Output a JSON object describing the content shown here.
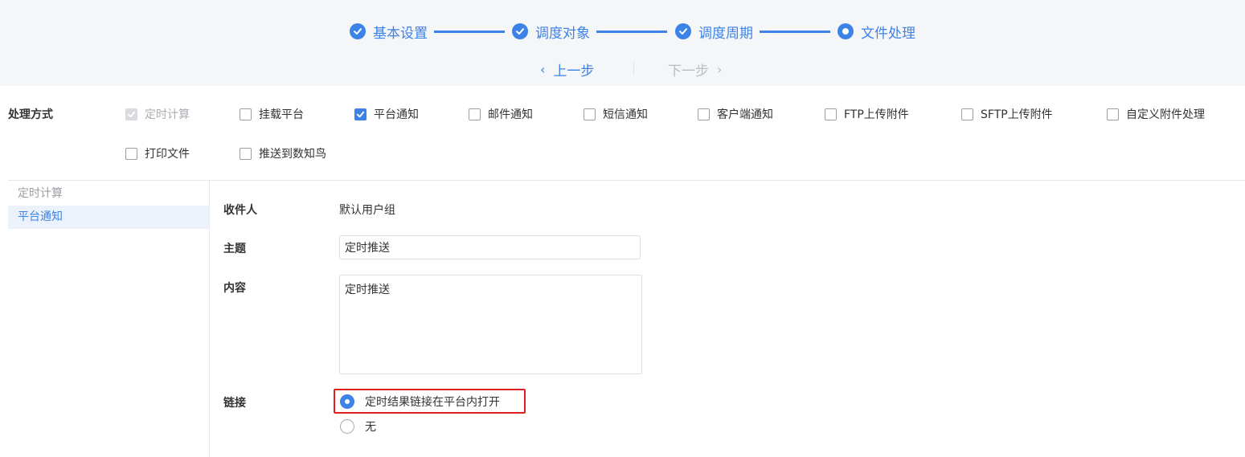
{
  "stepper": {
    "steps": [
      {
        "label": "基本设置",
        "state": "done"
      },
      {
        "label": "调度对象",
        "state": "done"
      },
      {
        "label": "调度周期",
        "state": "done"
      },
      {
        "label": "文件处理",
        "state": "current"
      }
    ],
    "prev_label": "上一步",
    "next_label": "下一步"
  },
  "methods": {
    "title": "处理方式",
    "options": [
      {
        "label": "定时计算",
        "checked": true,
        "disabled": true
      },
      {
        "label": "挂载平台",
        "checked": false
      },
      {
        "label": "平台通知",
        "checked": true
      },
      {
        "label": "邮件通知",
        "checked": false
      },
      {
        "label": "短信通知",
        "checked": false
      },
      {
        "label": "客户端通知",
        "checked": false
      },
      {
        "label": "FTP上传附件",
        "checked": false
      },
      {
        "label": "SFTP上传附件",
        "checked": false
      },
      {
        "label": "自定义附件处理",
        "checked": false
      },
      {
        "label": "打印文件",
        "checked": false
      },
      {
        "label": "推送到数知鸟",
        "checked": false
      }
    ]
  },
  "sidebar": {
    "items": [
      {
        "label": "定时计算",
        "active": false
      },
      {
        "label": "平台通知",
        "active": true
      }
    ]
  },
  "form": {
    "recipient_label": "收件人",
    "recipient_value": "默认用户组",
    "subject_label": "主题",
    "subject_value": "定时推送",
    "content_label": "内容",
    "content_value": "定时推送",
    "link_label": "链接",
    "link_options": [
      {
        "label": "定时结果链接在平台内打开",
        "checked": true
      },
      {
        "label": "无",
        "checked": false
      }
    ]
  },
  "colors": {
    "accent": "#3d82e6",
    "highlight": "#e02020",
    "header_bg": "#f5f6f8"
  }
}
